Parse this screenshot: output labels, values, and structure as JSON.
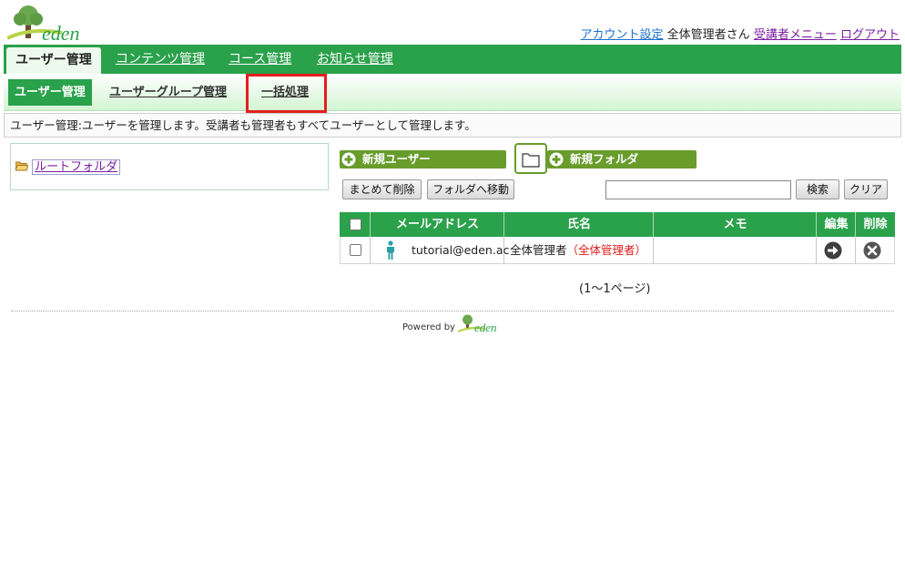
{
  "header": {
    "logo_text": "eden",
    "account_settings": "アカウント設定",
    "user_name": "全体管理者さん",
    "learner_menu": "受講者メニュー",
    "logout": "ログアウト"
  },
  "main_tabs": [
    "ユーザー管理",
    "コンテンツ管理",
    "コース管理",
    "お知らせ管理"
  ],
  "sub_tabs": [
    "ユーザー管理",
    "ユーザーグループ管理",
    "一括処理"
  ],
  "description": "ユーザー管理:ユーザーを管理します。受講者も管理者もすべてユーザーとして管理します。",
  "tree": {
    "root_folder": "ルートフォルダ"
  },
  "actions": {
    "new_user": "新規ユーザー",
    "new_folder": "新規フォルダ",
    "bulk_delete": "まとめて削除",
    "move_to_folder": "フォルダへ移動",
    "search": "検索",
    "clear": "クリア",
    "search_value": ""
  },
  "table": {
    "headers": [
      "メールアドレス",
      "氏名",
      "メモ",
      "編集",
      "削除"
    ],
    "rows": [
      {
        "email": "tutorial@eden.ac",
        "name": "全体管理者",
        "role": "（全体管理者）",
        "memo": ""
      }
    ]
  },
  "pager": "(1～1ページ)",
  "footer": {
    "powered_by": "Powered by",
    "logo_text": "eden"
  },
  "colors": {
    "primary_green": "#2aa14b",
    "button_green": "#689c2b",
    "highlight_red": "#e41f1f",
    "role_red": "#e02020"
  }
}
